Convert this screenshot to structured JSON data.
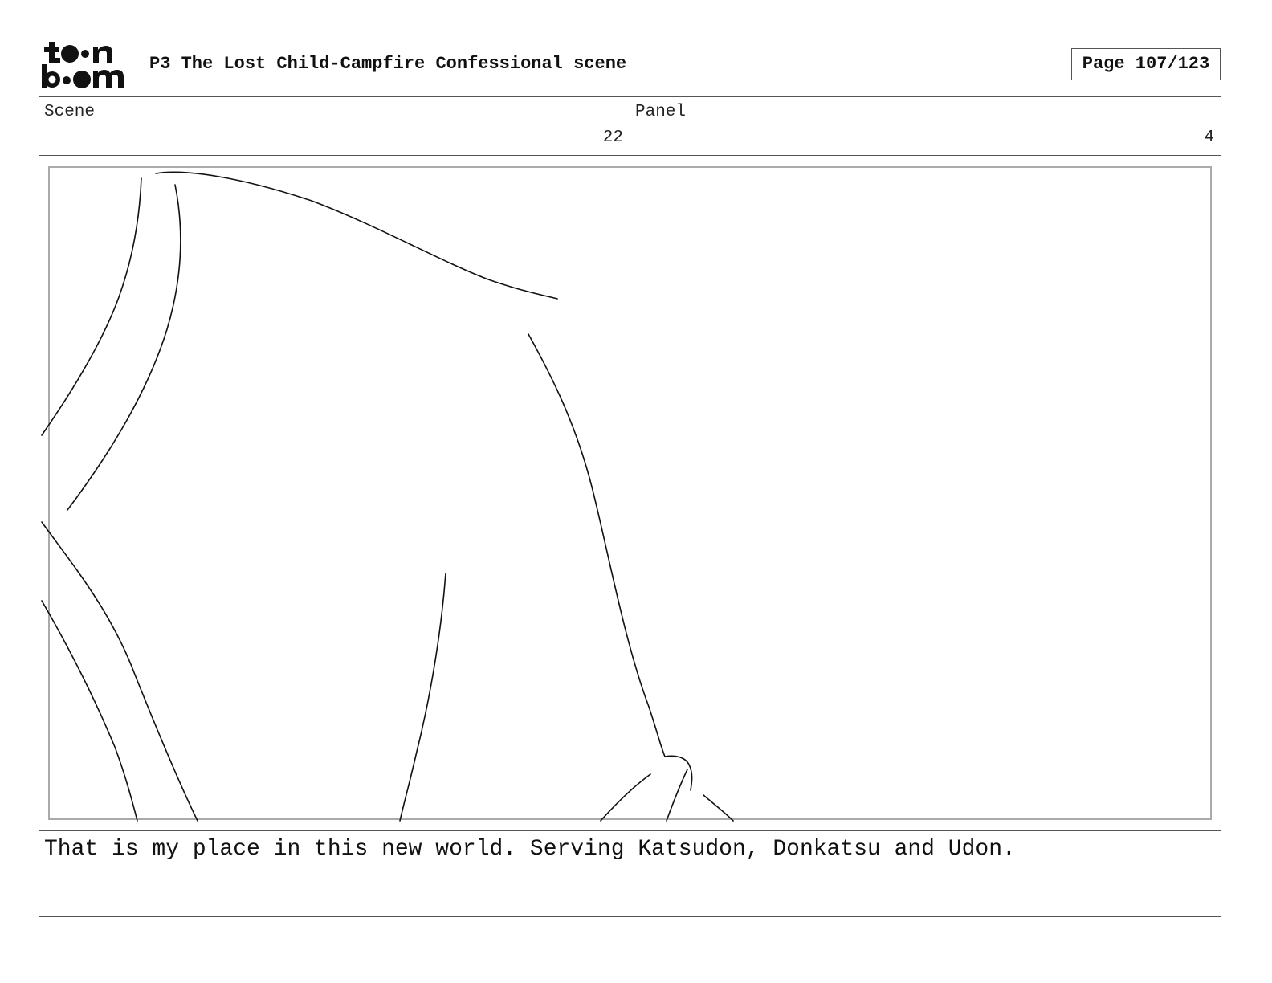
{
  "brand": {
    "logo_name": "toonboom-logo",
    "logo_line1": "toon",
    "logo_line2": "boom"
  },
  "header": {
    "title": "P3 The Lost Child-Campfire Confessional scene",
    "page_label": "Page 107/123"
  },
  "info": {
    "scene_label": "Scene",
    "scene_value": "22",
    "panel_label": "Panel",
    "panel_value": "4"
  },
  "panel": {
    "content": "rough sketch line drawing"
  },
  "dialogue": {
    "text": "That is my place in this new world. Serving Katsudon, Donkatsu and Udon."
  }
}
